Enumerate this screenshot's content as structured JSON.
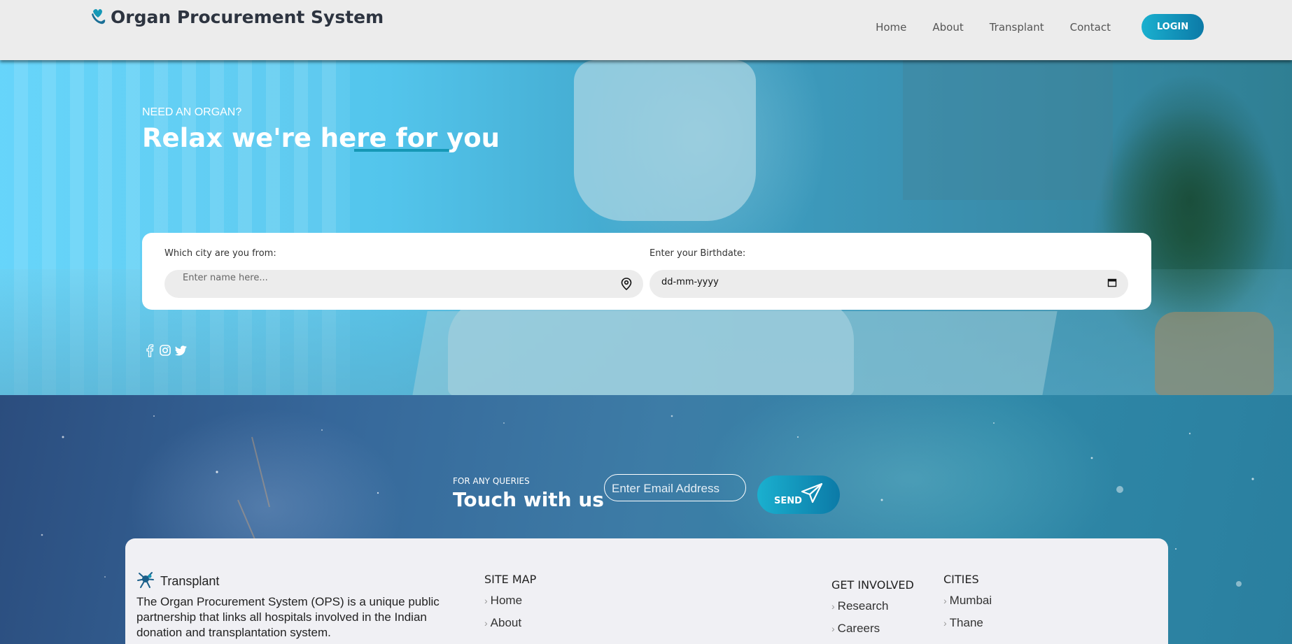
{
  "header": {
    "title": "Organ Procurement System",
    "nav": [
      "Home",
      "About",
      "Transplant",
      "Contact"
    ],
    "login_label": "LOGIN"
  },
  "hero": {
    "eyebrow": "NEED AN ORGAN?",
    "title": "Relax we're here for you",
    "city_label": "Which city are you from:",
    "city_placeholder": "Enter name here...",
    "birthdate_label": "Enter your Birthdate:",
    "birthdate_value": "dd-mm-yyyy",
    "socials": [
      "facebook-icon",
      "instagram-icon",
      "twitter-icon"
    ]
  },
  "query": {
    "eyebrow": "FOR ANY QUERIES",
    "title": "Touch with us",
    "email_placeholder": "Enter Email Address",
    "send_label": "SEND"
  },
  "footer": {
    "brand": "Transplant",
    "description": "The Organ Procurement System (OPS) is a unique public partnership that links all hospitals involved in the Indian donation and transplantation system.",
    "sitemap_title": "SITE MAP",
    "sitemap_links": [
      "Home",
      "About"
    ],
    "involved_title": "GET INVOLVED",
    "involved_links": [
      "Research",
      "Careers"
    ],
    "cities_title": "CITIES",
    "cities_links": [
      "Mumbai",
      "Thane"
    ]
  },
  "colors": {
    "accent": "#1598b6",
    "button_gradient_start": "#1ab0cf",
    "button_gradient_end": "#0c7aa7",
    "header_bg": "#ececec"
  }
}
